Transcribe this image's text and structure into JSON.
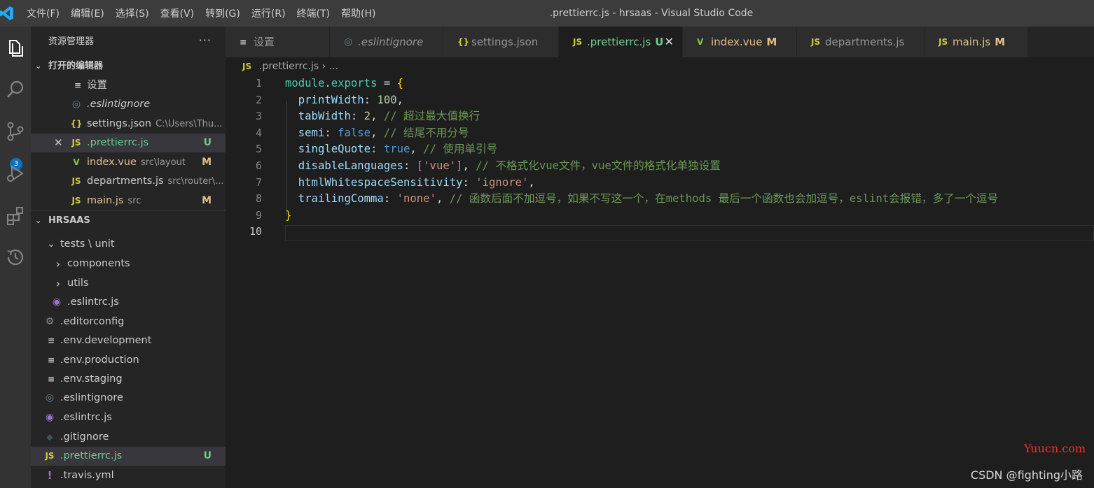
{
  "titlebar": {
    "menus": [
      "文件(F)",
      "编辑(E)",
      "选择(S)",
      "查看(V)",
      "转到(G)",
      "运行(R)",
      "终端(T)",
      "帮助(H)"
    ],
    "title": ".prettierrc.js - hrsaas - Visual Studio Code"
  },
  "activity": {
    "scm_badge": "3"
  },
  "sidebar": {
    "title": "资源管理器",
    "more": "···",
    "open_editors": {
      "header": "打开的编辑器",
      "items": [
        {
          "icon": "≡",
          "name": "设置",
          "dir": "",
          "status": ""
        },
        {
          "icon": "◎",
          "name": ".eslintignore",
          "dir": "",
          "status": ""
        },
        {
          "icon": "{}",
          "name": "settings.json",
          "dir": "C:\\Users\\Thu...",
          "status": ""
        },
        {
          "icon": "JS",
          "name": ".prettierrc.js",
          "dir": "",
          "status": "U",
          "close": "✕"
        },
        {
          "icon": "V",
          "name": "index.vue",
          "dir": "src\\layout",
          "status": "M"
        },
        {
          "icon": "JS",
          "name": "departments.js",
          "dir": "src\\router\\...",
          "status": ""
        },
        {
          "icon": "JS",
          "name": "main.js",
          "dir": "src",
          "status": "M"
        }
      ]
    },
    "project": {
      "header": "HRSAAS",
      "items": [
        {
          "icon": "⌄",
          "name": "tests \\ unit",
          "status": ""
        },
        {
          "icon": "›",
          "name": "components",
          "status": ""
        },
        {
          "icon": "›",
          "name": "utils",
          "status": ""
        },
        {
          "icon": "◉",
          "name": ".eslintrc.js",
          "status": ""
        },
        {
          "icon": "⚙",
          "name": ".editorconfig",
          "status": ""
        },
        {
          "icon": "≡",
          "name": ".env.development",
          "status": ""
        },
        {
          "icon": "≡",
          "name": ".env.production",
          "status": ""
        },
        {
          "icon": "≡",
          "name": ".env.staging",
          "status": ""
        },
        {
          "icon": "◎",
          "name": ".eslintignore",
          "status": ""
        },
        {
          "icon": "◉",
          "name": ".eslintrc.js",
          "status": ""
        },
        {
          "icon": "◆",
          "name": ".gitignore",
          "status": ""
        },
        {
          "icon": "JS",
          "name": ".prettierrc.js",
          "status": "U"
        },
        {
          "icon": "!",
          "name": ".travis.yml",
          "status": ""
        }
      ]
    }
  },
  "tabs": [
    {
      "icon": "≡",
      "label": "设置",
      "status": ""
    },
    {
      "icon": "◎",
      "label": ".eslintignore",
      "status": ""
    },
    {
      "icon": "{}",
      "label": "settings.json",
      "status": ""
    },
    {
      "icon": "JS",
      "label": ".prettierrc.js",
      "status": "U",
      "close": "✕"
    },
    {
      "icon": "V",
      "label": "index.vue",
      "status": "M"
    },
    {
      "icon": "JS",
      "label": "departments.js",
      "status": ""
    },
    {
      "icon": "JS",
      "label": "main.js",
      "status": "M"
    }
  ],
  "breadcrumb": {
    "icon": "JS",
    "file": ".prettierrc.js",
    "sep": "›",
    "rest": "..."
  },
  "editor": {
    "line_numbers": [
      "1",
      "2",
      "3",
      "4",
      "5",
      "6",
      "7",
      "8",
      "9",
      "10"
    ],
    "lines": [
      [
        {
          "t": "module",
          "c": "k"
        },
        {
          "t": ".",
          "c": ""
        },
        {
          "t": "exports",
          "c": "k"
        },
        {
          "t": " = ",
          "c": ""
        },
        {
          "t": "{",
          "c": "br"
        }
      ],
      [
        {
          "t": "  printWidth",
          "c": "p"
        },
        {
          "t": ": ",
          "c": ""
        },
        {
          "t": "100",
          "c": "n"
        },
        {
          "t": ",",
          "c": ""
        }
      ],
      [
        {
          "t": "  tabWidth",
          "c": "p"
        },
        {
          "t": ": ",
          "c": ""
        },
        {
          "t": "2",
          "c": "n"
        },
        {
          "t": ", ",
          "c": ""
        },
        {
          "t": "// 超过最大值换行",
          "c": "c"
        }
      ],
      [
        {
          "t": "  semi",
          "c": "p"
        },
        {
          "t": ": ",
          "c": ""
        },
        {
          "t": "false",
          "c": "b"
        },
        {
          "t": ", ",
          "c": ""
        },
        {
          "t": "// 结尾不用分号",
          "c": "c"
        }
      ],
      [
        {
          "t": "  singleQuote",
          "c": "p"
        },
        {
          "t": ": ",
          "c": ""
        },
        {
          "t": "true",
          "c": "b"
        },
        {
          "t": ", ",
          "c": ""
        },
        {
          "t": "// 使用单引号",
          "c": "c"
        }
      ],
      [
        {
          "t": "  disableLanguages",
          "c": "p"
        },
        {
          "t": ": ",
          "c": ""
        },
        {
          "t": "[",
          "c": "br2"
        },
        {
          "t": "'vue'",
          "c": "s"
        },
        {
          "t": "]",
          "c": "br2"
        },
        {
          "t": ", ",
          "c": ""
        },
        {
          "t": "// 不格式化vue文件，vue文件的格式化单独设置",
          "c": "c"
        }
      ],
      [
        {
          "t": "  htmlWhitespaceSensitivity",
          "c": "p"
        },
        {
          "t": ": ",
          "c": ""
        },
        {
          "t": "'ignore'",
          "c": "s"
        },
        {
          "t": ",",
          "c": ""
        }
      ],
      [
        {
          "t": "  trailingComma",
          "c": "p"
        },
        {
          "t": ": ",
          "c": ""
        },
        {
          "t": "'none'",
          "c": "s"
        },
        {
          "t": ", ",
          "c": ""
        },
        {
          "t": "// 函数后面不加逗号，如果不写这一个，在methods 最后一个函数也会加逗号，eslint会报错，多了一个逗号",
          "c": "c"
        }
      ],
      [
        {
          "t": "}",
          "c": "br"
        }
      ],
      []
    ]
  },
  "watermarks": {
    "site": "Yuucn.com",
    "author": "CSDN @fighting小路"
  },
  "colors": {
    "js": "#cbcb41",
    "vue": "#8dc149",
    "modified": "#e2c08d",
    "untracked": "#73c991",
    "json": "#cbcb41",
    "eslint": "#a074c4"
  }
}
